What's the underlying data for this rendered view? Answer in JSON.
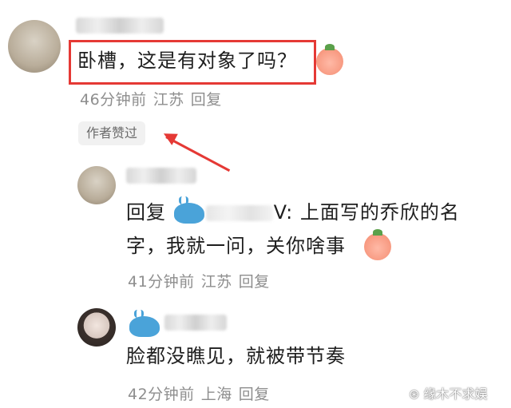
{
  "comments": [
    {
      "text": "卧槽，这是有对象了吗？",
      "meta": {
        "time": "46分钟前",
        "location": "江苏",
        "reply": "回复"
      },
      "badge": "作者赞过"
    },
    {
      "reply_prefix": "回复",
      "reply_target_suffix": "V:",
      "text_line1": "上面写的乔欣的名",
      "text_line2": "字，我就一问，关你啥事",
      "meta": {
        "time": "41分钟前",
        "location": "江苏",
        "reply": "回复"
      }
    },
    {
      "text": "脸都没瞧见，就被带节奏",
      "meta": {
        "time": "42分钟前",
        "location": "上海",
        "reply": "回复"
      }
    }
  ],
  "watermark": "缘木不求娱",
  "colors": {
    "highlight": "#e53935",
    "meta_text": "#8e8e8e",
    "badge_bg": "#f1f1f1"
  }
}
